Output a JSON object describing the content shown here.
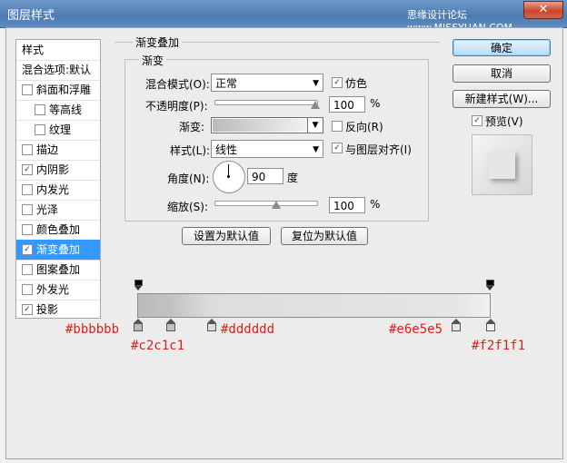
{
  "window": {
    "title": "图层样式",
    "watermark": "思缘设计论坛 www.MISSYUAN.COM",
    "close": "✕"
  },
  "style_list": {
    "header": "样式",
    "blend_options": "混合选项:默认",
    "items": [
      {
        "label": "斜面和浮雕",
        "checked": false
      },
      {
        "label": "等高线",
        "checked": false
      },
      {
        "label": "纹理",
        "checked": false
      },
      {
        "label": "描边",
        "checked": false
      },
      {
        "label": "内阴影",
        "checked": true
      },
      {
        "label": "内发光",
        "checked": false
      },
      {
        "label": "光泽",
        "checked": false
      },
      {
        "label": "颜色叠加",
        "checked": false
      },
      {
        "label": "渐变叠加",
        "checked": true
      },
      {
        "label": "图案叠加",
        "checked": false
      },
      {
        "label": "外发光",
        "checked": false
      },
      {
        "label": "投影",
        "checked": true
      }
    ]
  },
  "panel": {
    "outer_title": "渐变叠加",
    "inner_title": "渐变",
    "blend_mode_label": "混合模式(O):",
    "blend_mode_value": "正常",
    "dither_label": "仿色",
    "dither_checked": true,
    "opacity_label": "不透明度(P):",
    "opacity_value": "100",
    "opacity_unit": "%",
    "gradient_label": "渐变:",
    "reverse_label": "反向(R)",
    "reverse_checked": false,
    "style_label": "样式(L):",
    "style_value": "线性",
    "align_label": "与图层对齐(I)",
    "align_checked": true,
    "angle_label": "角度(N):",
    "angle_value": "90",
    "angle_unit": "度",
    "scale_label": "缩放(S):",
    "scale_value": "100",
    "scale_unit": "%",
    "make_default": "设置为默认值",
    "reset_default": "复位为默认值"
  },
  "buttons": {
    "ok": "确定",
    "cancel": "取消",
    "new_style": "新建样式(W)...",
    "preview_label": "预览(V)",
    "preview_checked": true
  },
  "gradient_stops": {
    "stops": [
      {
        "color": "#bbbbbb",
        "label": "#bbbbbb"
      },
      {
        "color": "#c2c1c1",
        "label": "#c2c1c1"
      },
      {
        "color": "#dddddd",
        "label": "#dddddd"
      },
      {
        "color": "#e6e5e5",
        "label": "#e6e5e5"
      },
      {
        "color": "#f2f1f1",
        "label": "#f2f1f1"
      }
    ]
  }
}
